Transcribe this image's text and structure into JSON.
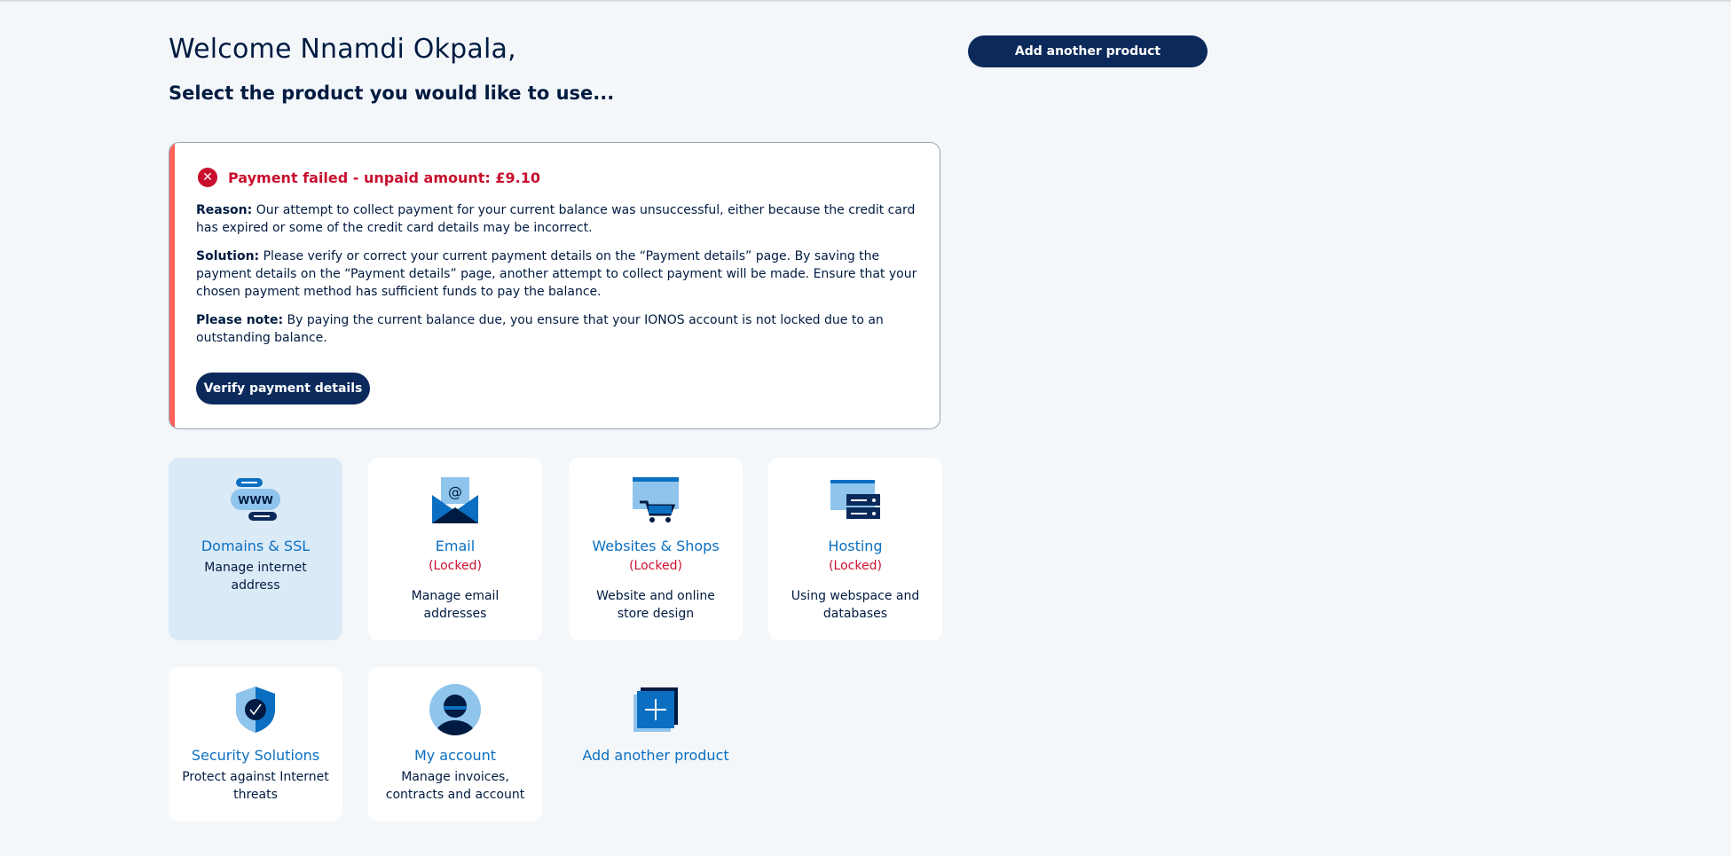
{
  "header": {
    "welcome": "Welcome Nnamdi Okpala,",
    "subtitle": "Select the product you would like to use...",
    "add_product_label": "Add another product"
  },
  "alert": {
    "title": "Payment failed - unpaid amount: £9.10",
    "reason_label": "Reason:",
    "reason_text": "Our attempt to collect payment for your current balance was unsuccessful, either because the credit card has expired or some of the credit card details may be incorrect.",
    "solution_label": "Solution:",
    "solution_text": "Please verify or correct your current payment details on the “Payment details” page. By saving the payment details on the “Payment details” page, another attempt to collect payment will be made. Ensure that your chosen payment method has sufficient funds to pay the balance.",
    "note_label": "Please note:",
    "note_text": "By paying the current balance due, you ensure that your IONOS account is not locked due to an outstanding balance.",
    "button_label": "Verify payment details",
    "colors": {
      "accent": "#ff6159",
      "error": "#c8102e"
    }
  },
  "tiles": [
    {
      "icon": "www-domain-icon",
      "title": "Domains & SSL",
      "locked": "",
      "desc": "Manage internet address",
      "active": true
    },
    {
      "icon": "email-envelope-icon",
      "title": "Email",
      "locked": "(Locked)",
      "desc": "Manage email addresses"
    },
    {
      "icon": "shopping-cart-icon",
      "title": "Websites & Shops",
      "locked": "(Locked)",
      "desc": "Website and online store design"
    },
    {
      "icon": "server-hosting-icon",
      "title": "Hosting",
      "locked": "(Locked)",
      "desc": "Using webspace and databases"
    },
    {
      "icon": "shield-check-icon",
      "title": "Security Solutions",
      "locked": "",
      "desc": "Protect against Internet threats"
    },
    {
      "icon": "user-account-icon",
      "title": "My account",
      "locked": "",
      "desc": "Manage invoices, contracts and account"
    },
    {
      "icon": "add-product-icon",
      "title": "Add another product",
      "locked": "",
      "desc": ""
    }
  ],
  "colors": {
    "primary": "#0b2a5b",
    "link": "#0b6fc1",
    "background": "#f4f7fa"
  }
}
